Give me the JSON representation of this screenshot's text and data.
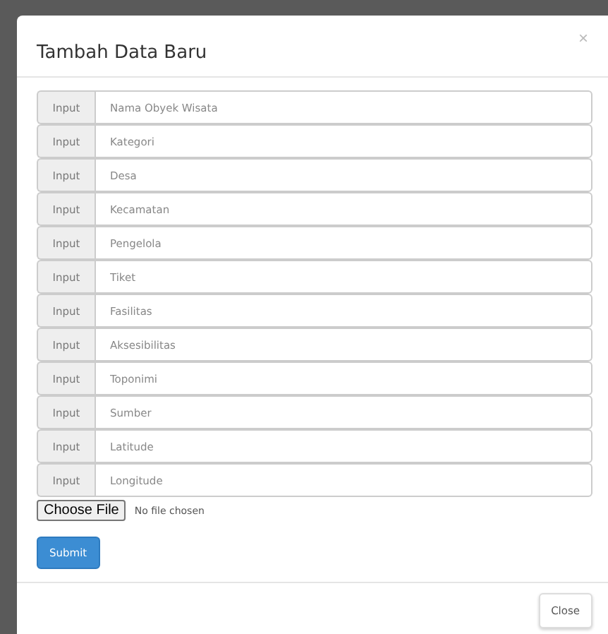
{
  "modal": {
    "title": "Tambah Data Baru",
    "close_icon": "×"
  },
  "fields": [
    {
      "addon": "Input",
      "placeholder": "Nama Obyek Wisata"
    },
    {
      "addon": "Input",
      "placeholder": "Kategori"
    },
    {
      "addon": "Input",
      "placeholder": "Desa"
    },
    {
      "addon": "Input",
      "placeholder": "Kecamatan"
    },
    {
      "addon": "Input",
      "placeholder": "Pengelola"
    },
    {
      "addon": "Input",
      "placeholder": "Tiket"
    },
    {
      "addon": "Input",
      "placeholder": "Fasilitas"
    },
    {
      "addon": "Input",
      "placeholder": "Aksesibilitas"
    },
    {
      "addon": "Input",
      "placeholder": "Toponimi"
    },
    {
      "addon": "Input",
      "placeholder": "Sumber"
    },
    {
      "addon": "Input",
      "placeholder": "Latitude"
    },
    {
      "addon": "Input",
      "placeholder": "Longitude"
    }
  ],
  "file_input": {
    "button": "Choose File",
    "status": "No file chosen"
  },
  "submit": "Submit",
  "footer_button": "Close"
}
